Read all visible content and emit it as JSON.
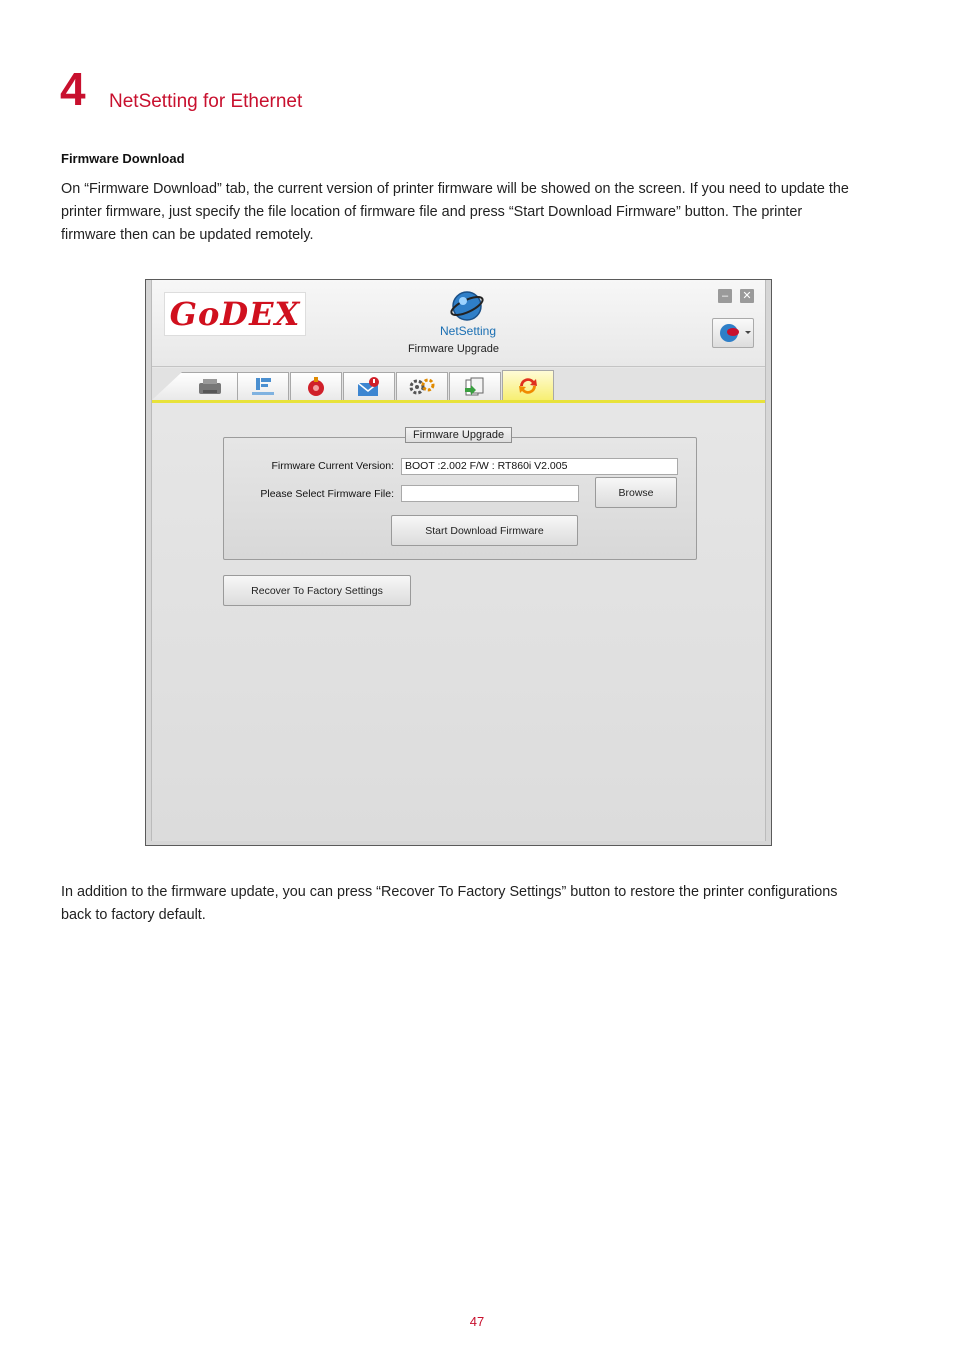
{
  "chapter": {
    "number": "4",
    "title": "NetSetting for Ethernet"
  },
  "section": {
    "heading": "Firmware Download",
    "intro": "On “Firmware Download” tab, the current version of printer firmware will be showed on the screen. If you need to update the printer firmware, just specify the file location of firmware file and press “Start Download Firmware” button. The printer firmware then can be updated remotely.",
    "closing": "In addition to the firmware update, you can press “Recover To Factory Settings” button to restore the printer configurations back to factory default."
  },
  "app": {
    "logo_text": "GoDEX",
    "name": "NetSetting",
    "subtitle": "Firmware Upgrade",
    "tabs": [
      {
        "icon": "printer-icon"
      },
      {
        "icon": "network-icon"
      },
      {
        "icon": "alarm-icon"
      },
      {
        "icon": "mail-alert-icon"
      },
      {
        "icon": "gears-icon"
      },
      {
        "icon": "file-transfer-icon"
      },
      {
        "icon": "refresh-icon",
        "active": true
      }
    ],
    "firmware": {
      "group_title": "Firmware Upgrade",
      "version_label": "Firmware Current Version:",
      "version_value": "BOOT :2.002  F/W : RT860i V2.005",
      "file_label": "Please Select Firmware File:",
      "file_value": "",
      "browse_label": "Browse",
      "start_label": "Start Download Firmware"
    },
    "recover_label": "Recover To Factory  Settings"
  },
  "colors": {
    "accent": "#c8102e",
    "active_tab": "#f7ef72"
  },
  "page_number": "47"
}
